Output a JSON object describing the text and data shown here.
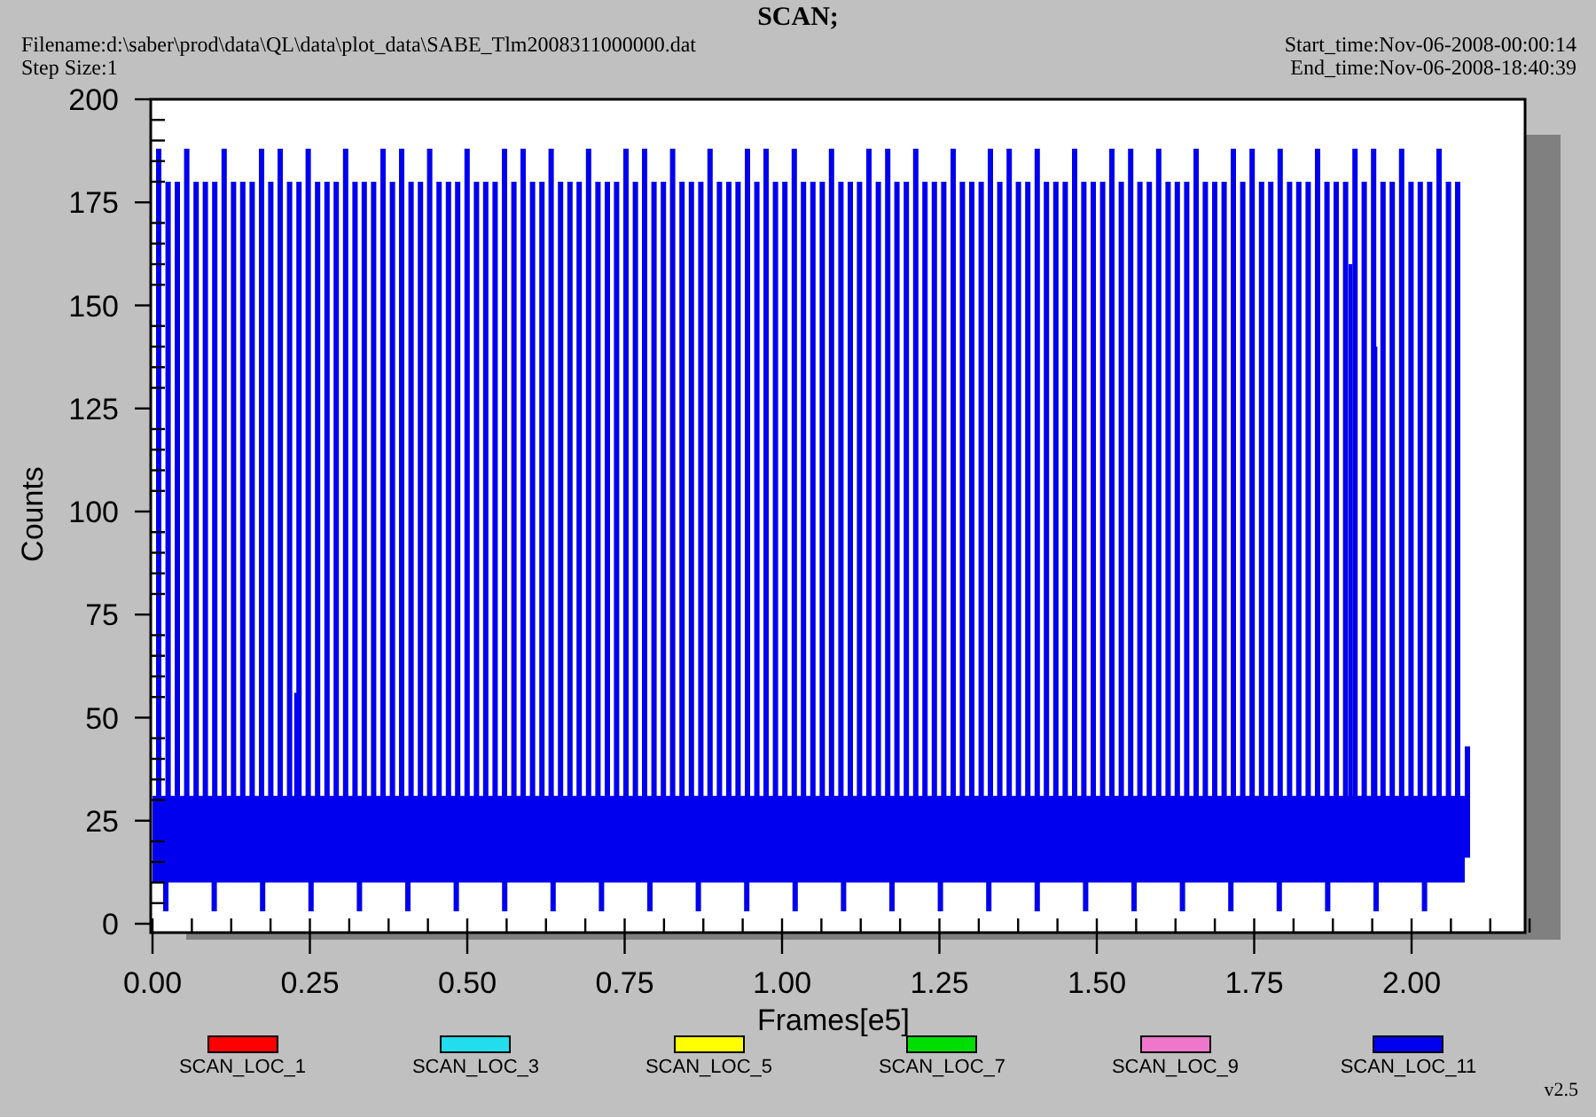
{
  "title": "SCAN;",
  "filename": "Filename:d:\\saber\\prod\\data\\QL\\data\\plot_data\\SABE_Tlm2008311000000.dat",
  "step_size": "Step Size:1",
  "start_time": "Start_time:Nov-06-2008-00:00:14",
  "end_time": "End_time:Nov-06-2008-18:40:39",
  "plot": {
    "ylabel": "Counts",
    "xlabel": "Frames[e5]",
    "y_tick_labels": [
      "200",
      "175",
      "150",
      "125",
      "100",
      "75",
      "50",
      "25",
      "0"
    ],
    "x_tick_labels": [
      "0.00",
      "0.25",
      "0.50",
      "0.75",
      "1.00",
      "1.25",
      "1.50",
      "1.75",
      "2.00"
    ]
  },
  "legend": [
    {
      "label": "SCAN_LOC_1",
      "color": "#ff0000"
    },
    {
      "label": "SCAN_LOC_3",
      "color": "#22ddee"
    },
    {
      "label": "SCAN_LOC_5",
      "color": "#ffff00"
    },
    {
      "label": "SCAN_LOC_7",
      "color": "#00dd00"
    },
    {
      "label": "SCAN_LOC_9",
      "color": "#ee77cc"
    },
    {
      "label": "SCAN_LOC_11",
      "color": "#0000ee"
    }
  ],
  "version": "v2.5"
}
